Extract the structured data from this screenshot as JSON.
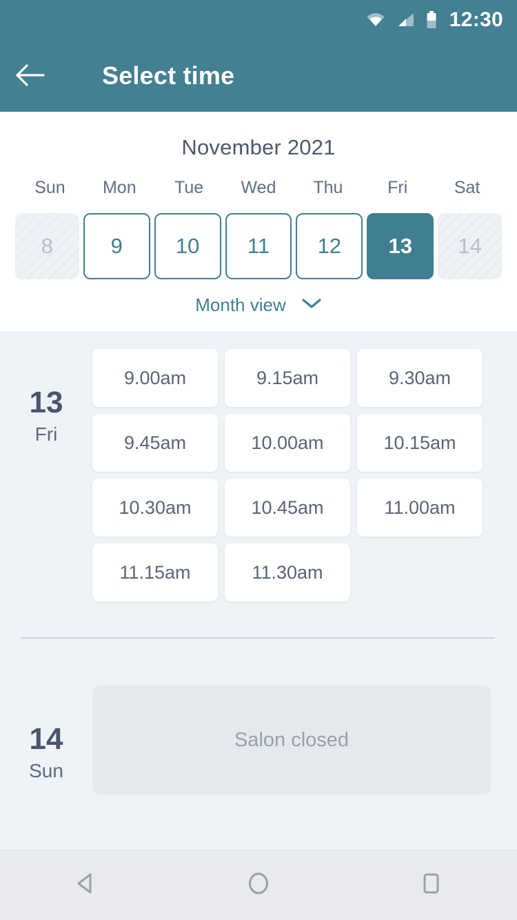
{
  "status_bar": {
    "clock": "12:30",
    "icons": [
      "wifi-icon",
      "signal-icon",
      "battery-icon"
    ]
  },
  "app_bar": {
    "back_icon": "back-arrow-icon",
    "title": "Select time"
  },
  "calendar": {
    "month_title": "November 2021",
    "weekdays": [
      "Sun",
      "Mon",
      "Tue",
      "Wed",
      "Thu",
      "Fri",
      "Sat"
    ],
    "days": [
      {
        "number": "8",
        "state": "disabled"
      },
      {
        "number": "9",
        "state": "available"
      },
      {
        "number": "10",
        "state": "available"
      },
      {
        "number": "11",
        "state": "available"
      },
      {
        "number": "12",
        "state": "available"
      },
      {
        "number": "13",
        "state": "selected"
      },
      {
        "number": "14",
        "state": "disabled"
      }
    ],
    "month_view_label": "Month view",
    "month_view_icon": "chevron-down-icon"
  },
  "schedule": [
    {
      "day_number": "13",
      "day_of_week": "Fri",
      "slots": [
        "9.00am",
        "9.15am",
        "9.30am",
        "9.45am",
        "10.00am",
        "10.15am",
        "10.30am",
        "10.45am",
        "11.00am",
        "11.15am",
        "11.30am"
      ],
      "closed_message": null
    },
    {
      "day_number": "14",
      "day_of_week": "Sun",
      "slots": [],
      "closed_message": "Salon closed"
    }
  ],
  "nav_bar": {
    "buttons": [
      "back-triangle-icon",
      "home-circle-icon",
      "recents-square-icon"
    ]
  },
  "colors": {
    "accent_teal": "#428092",
    "selected_day": "#3f7f91",
    "page_background": "#eff2f7",
    "card_background": "#ffffff",
    "closed_box": "#e5e8ed",
    "text_dark": "#48556b",
    "text_muted": "#97a0ae",
    "nav_bar": "#e8eaed"
  }
}
